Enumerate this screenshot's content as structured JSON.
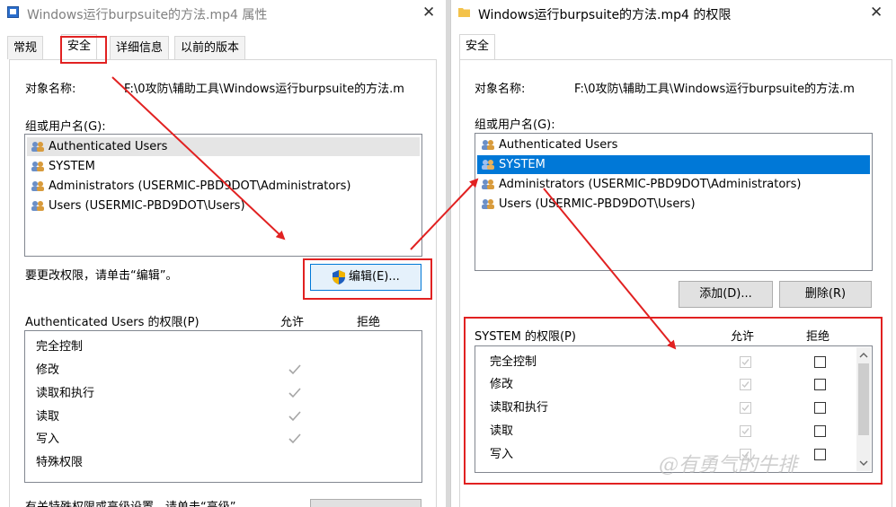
{
  "left_window": {
    "title": "Windows运行burpsuite的方法.mp4 属性",
    "tabs": [
      "常规",
      "安全",
      "详细信息",
      "以前的版本"
    ],
    "object_label": "对象名称:",
    "object_path": "F:\\0攻防\\辅助工具\\Windows运行burpsuite的方法.m",
    "groups_label": "组或用户名(G):",
    "users": [
      "Authenticated Users",
      "SYSTEM",
      "Administrators (USERMIC-PBD9DOT\\Administrators)",
      "Users (USERMIC-PBD9DOT\\Users)"
    ],
    "edit_hint": "要更改权限，请单击“编辑”。",
    "edit_button": "编辑(E)...",
    "perm_title": "Authenticated Users 的权限(P)",
    "allow_label": "允许",
    "deny_label": "拒绝",
    "permissions": [
      "完全控制",
      "修改",
      "读取和执行",
      "读取",
      "写入",
      "特殊权限"
    ],
    "allow_checked": [
      false,
      true,
      true,
      true,
      true,
      false
    ],
    "bottom_hint": "有关特殊权限或高级设置，请单击“高级”。"
  },
  "right_window": {
    "title": "Windows运行burpsuite的方法.mp4 的权限",
    "tab": "安全",
    "object_label": "对象名称:",
    "object_path": "F:\\0攻防\\辅助工具\\Windows运行burpsuite的方法.m",
    "groups_label": "组或用户名(G):",
    "users": [
      "Authenticated Users",
      "SYSTEM",
      "Administrators (USERMIC-PBD9DOT\\Administrators)",
      "Users (USERMIC-PBD9DOT\\Users)"
    ],
    "selected_user_index": 1,
    "add_button": "添加(D)...",
    "remove_button": "删除(R)",
    "perm_title": "SYSTEM 的权限(P)",
    "allow_label": "允许",
    "deny_label": "拒绝",
    "permissions": [
      "完全控制",
      "修改",
      "读取和执行",
      "读取",
      "写入"
    ],
    "allow_checked": [
      true,
      true,
      true,
      true,
      true
    ],
    "deny_checked": [
      false,
      false,
      false,
      false,
      false
    ]
  },
  "watermark": "@有勇气的牛排",
  "colors": {
    "selection": "#0078d7",
    "annotation": "#e12121",
    "shield_blue": "#1f5fbf",
    "shield_yellow": "#f2b400"
  },
  "icons": [
    "file-icon",
    "folder-icon",
    "users-icon",
    "uac-shield-icon",
    "checkmark-icon",
    "scroll-up-icon",
    "scroll-down-icon"
  ]
}
